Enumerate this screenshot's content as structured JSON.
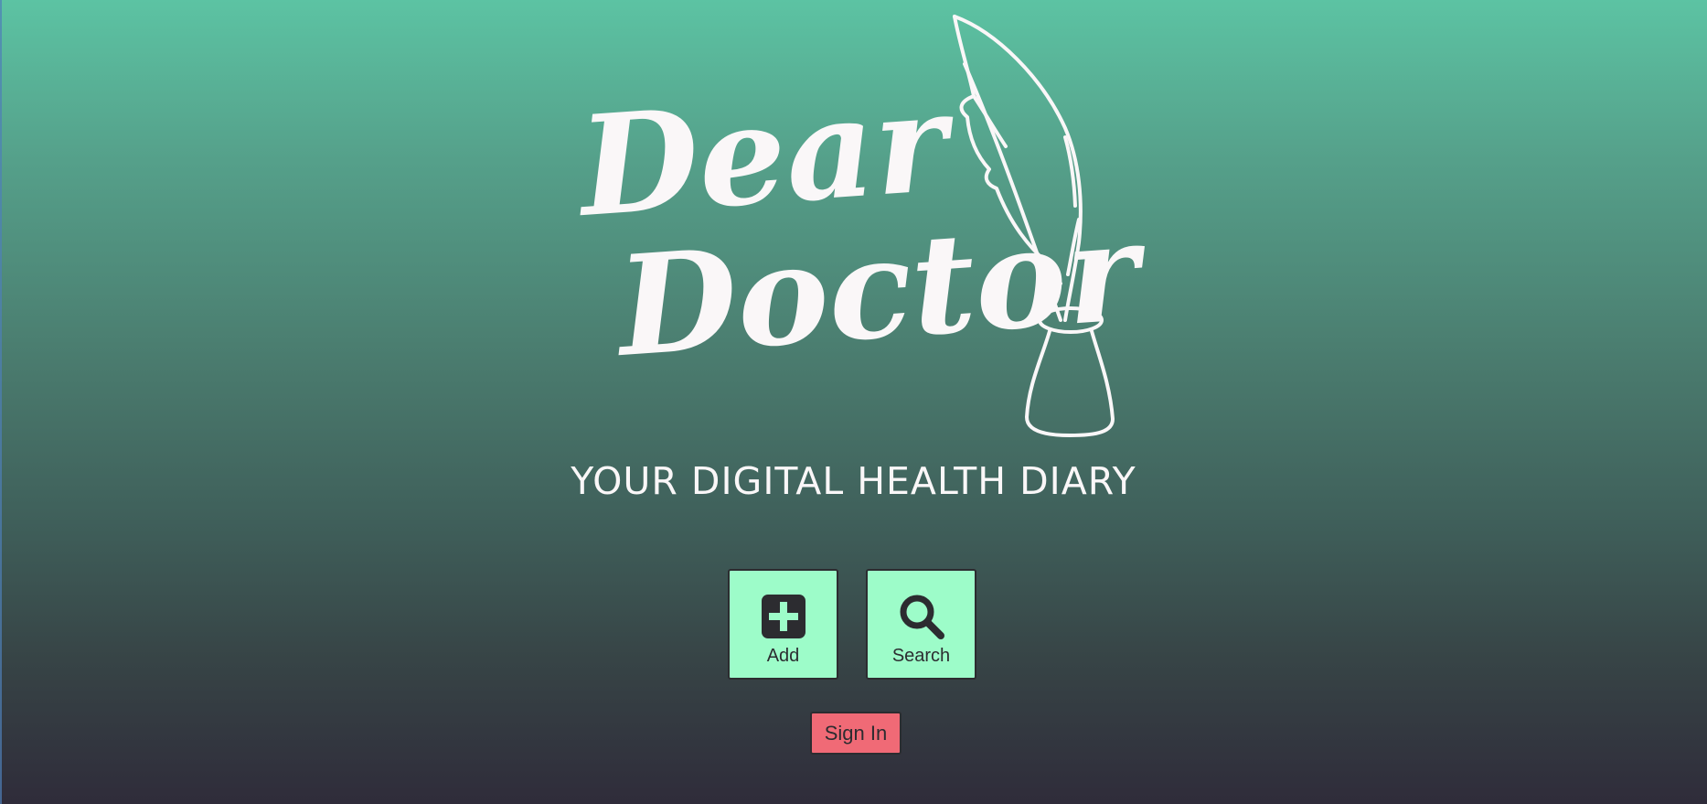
{
  "brand": {
    "name_line1": "Dear",
    "name_line2": "Doctor",
    "tagline": "YOUR DIGITAL HEALTH DIARY"
  },
  "actions": [
    {
      "label": "Add",
      "icon": "plus-square-icon"
    },
    {
      "label": "Search",
      "icon": "magnifier-icon"
    }
  ],
  "auth": {
    "sign_in_label": "Sign In"
  },
  "colors": {
    "gradient_top": "#5cc3a3",
    "gradient_bottom": "#2f2c3a",
    "tile_background": "#9dfcc9",
    "signin_background": "#f06a76",
    "logo_color": "#faf7f8",
    "icon_color": "#2c2c30"
  }
}
